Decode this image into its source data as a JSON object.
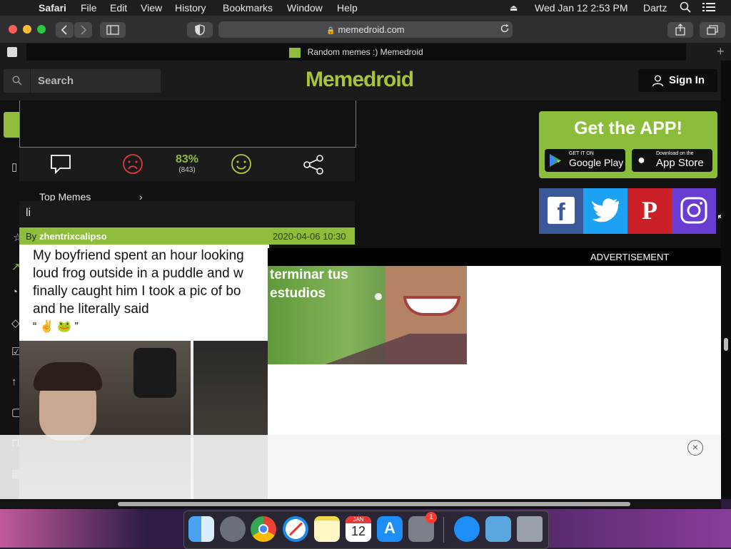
{
  "menubar": {
    "app_name": "Safari",
    "items": [
      "File",
      "Edit",
      "View",
      "History",
      "Bookmarks",
      "Window",
      "Help"
    ],
    "datetime": "Wed Jan 12  2:53 PM",
    "user": "Dartz"
  },
  "browser": {
    "url": "memedroid.com",
    "tab_title": "Random memes :) Memedroid"
  },
  "site": {
    "search_placeholder": "Search",
    "logo": "Memedroid",
    "signin_label": "Sign In"
  },
  "post": {
    "rating_percent": "83%",
    "rating_votes": "(843)",
    "top_memes": "Top Memes",
    "partial_text": "li",
    "author_prefix": "By",
    "author": "zhentrixcalipso",
    "date": "2020-04-06 10:30",
    "caption_lines": [
      "My boyfriend spent an hour looking",
      "loud frog outside in a puddle and w",
      "finally caught him I took a pic of bo",
      "and he literally said"
    ],
    "caption_quote": "“ ✌️ 🐸 ”"
  },
  "sidebar": {
    "getapp_title": "Get the APP!",
    "google_play_small": "GET IT ON",
    "google_play_big": "Google Play",
    "app_store_small": "Download on the",
    "app_store_big": "App Store",
    "social": [
      {
        "name": "facebook",
        "glyph": "f",
        "color": "#3b5998"
      },
      {
        "name": "twitter",
        "glyph": "🐦",
        "color": "#1da1f2"
      },
      {
        "name": "pinterest",
        "glyph": "P",
        "color": "#cb2027"
      },
      {
        "name": "instagram",
        "glyph": "◎",
        "color": "#6a3dd2"
      }
    ]
  },
  "ad": {
    "label": "ADVERTISEMENT",
    "text": "terminar tus estudios",
    "close": "×"
  },
  "dock": {
    "calendar_month": "JAN",
    "calendar_day": "12",
    "notification_badge": "1"
  }
}
